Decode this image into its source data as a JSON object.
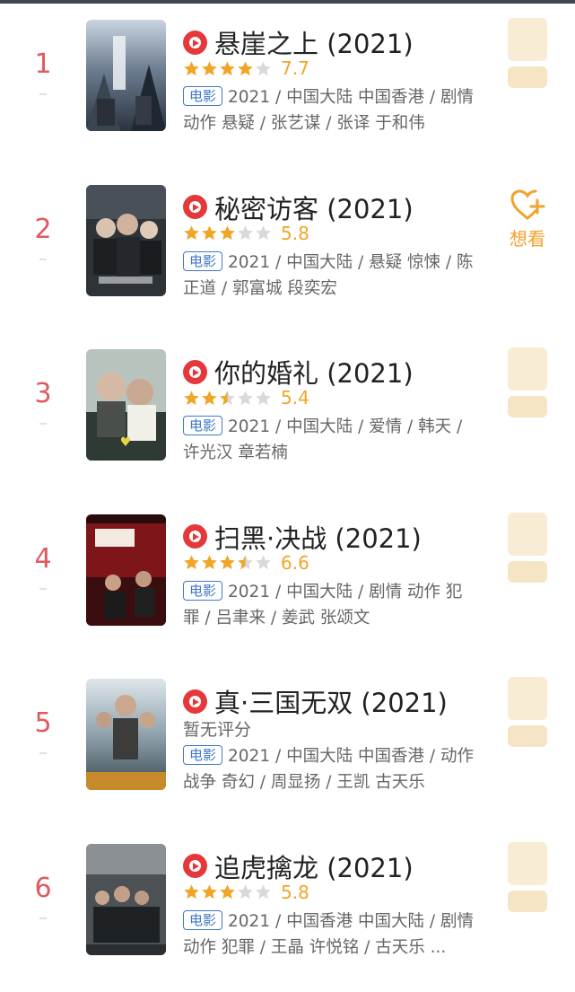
{
  "tag_label": "电影",
  "want_label": "想看",
  "colors": {
    "rank": "#e05a5f",
    "star": "#f0a526",
    "tag": "#3f78c8",
    "want": "#f2a22a"
  },
  "movies": [
    {
      "rank": "1",
      "title": "悬崖之上 (2021)",
      "stars": 4,
      "score": "7.7",
      "meta": "2021 / 中国大陆 中国香港 / 剧情 动作 悬疑 / 张艺谋 / 张译 于和伟"
    },
    {
      "rank": "2",
      "title": "秘密访客 (2021)",
      "stars": 3,
      "score": "5.8",
      "meta": "2021 / 中国大陆 / 悬疑 惊悚 / 陈正道 / 郭富城 段奕宏"
    },
    {
      "rank": "3",
      "title": "你的婚礼 (2021)",
      "stars": 2.5,
      "score": "5.4",
      "meta": "2021 / 中国大陆 / 爱情 / 韩天 / 许光汉 章若楠"
    },
    {
      "rank": "4",
      "title": "扫黑·决战 (2021)",
      "stars": 3.5,
      "score": "6.6",
      "meta": "2021 / 中国大陆 / 剧情 动作 犯罪 / 吕聿来 / 姜武 张颂文"
    },
    {
      "rank": "5",
      "title": "真·三国无双 (2021)",
      "stars": 0,
      "score": "暂无评分",
      "meta": "2021 / 中国大陆 中国香港 / 动作 战争 奇幻 / 周显扬 / 王凯 古天乐"
    },
    {
      "rank": "6",
      "title": "追虎擒龙 (2021)",
      "stars": 3,
      "score": "5.8",
      "meta": "2021 / 中国香港 中国大陆 / 剧情 动作 犯罪 / 王晶 许悦铭 / 古天乐 ..."
    }
  ]
}
